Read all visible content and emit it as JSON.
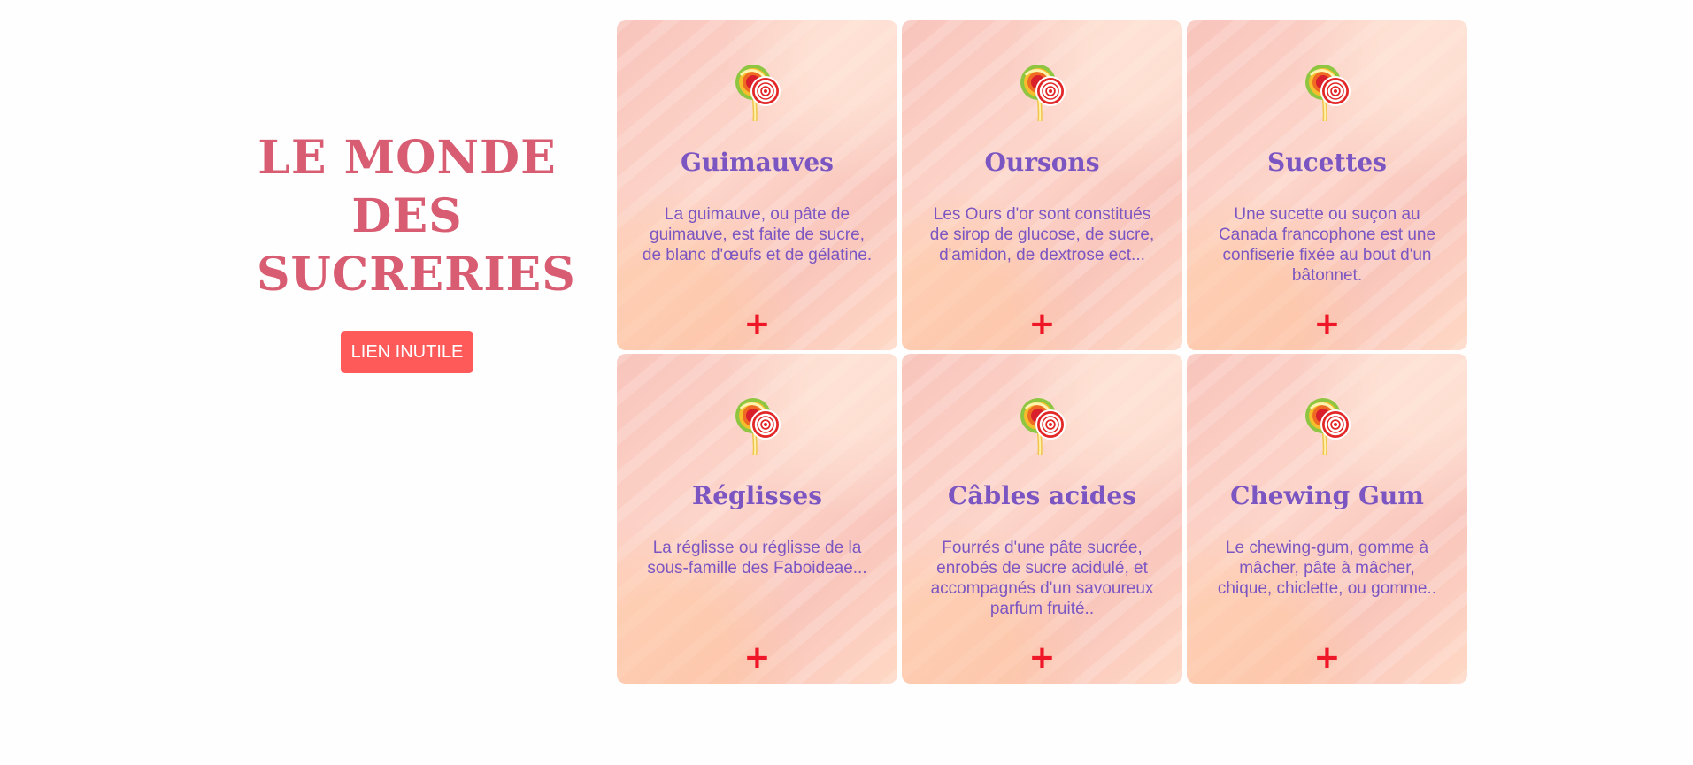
{
  "hero": {
    "title": "LE MONDE DES SUCRERIES",
    "button_label": "LIEN INUTILE"
  },
  "colors": {
    "title": "#d95d72",
    "button": "#ff5a5a",
    "card_text": "#7b56c2",
    "plus": "#ef1727"
  },
  "cards": [
    {
      "title": "Guimauves",
      "description": "La guimauve, ou pâte de guimauve, est faite de sucre, de blanc d'œufs et de gélatine.",
      "icon": "lollipop-icon",
      "action": "+"
    },
    {
      "title": "Oursons",
      "description": "Les Ours d'or sont constitués de sirop de glucose, de sucre, d'amidon, de dextrose ect...",
      "icon": "lollipop-icon",
      "action": "+"
    },
    {
      "title": "Sucettes",
      "description": "Une sucette ou suçon au Canada francophone est une confiserie fixée au bout d'un bâtonnet.",
      "icon": "lollipop-icon",
      "action": "+"
    },
    {
      "title": "Réglisses",
      "description": "La réglisse ou réglisse de la sous-famille des Faboideae...",
      "icon": "lollipop-icon",
      "action": "+"
    },
    {
      "title": "Câbles acides",
      "description": "Fourrés d'une pâte sucrée, enrobés de sucre acidulé, et accompagnés d'un savoureux parfum fruité..",
      "icon": "lollipop-icon",
      "action": "+"
    },
    {
      "title": "Chewing Gum",
      "description": "Le chewing-gum, gomme à mâcher, pâte à mâcher, chique, chiclette, ou gomme..",
      "icon": "lollipop-icon",
      "action": "+"
    }
  ]
}
